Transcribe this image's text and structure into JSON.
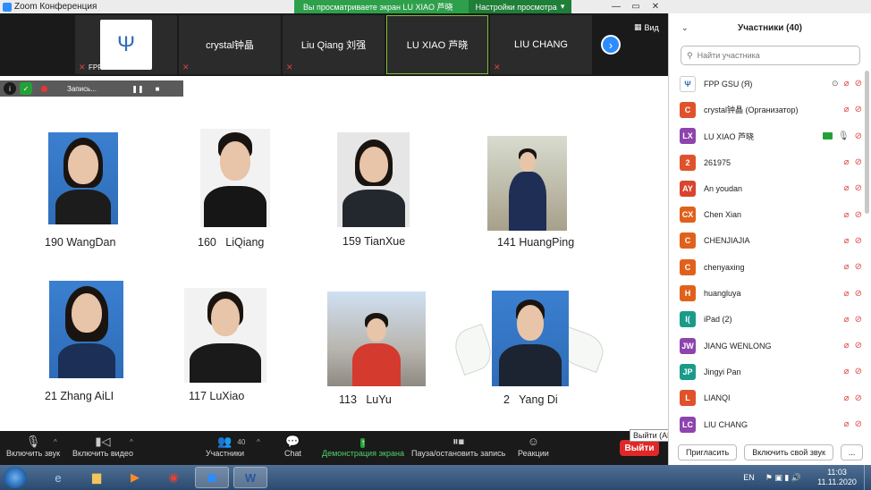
{
  "window": {
    "title": "Zoom Конференция"
  },
  "banner": {
    "message": "Вы просматриваете экран LU XIAO 芦晓",
    "options_label": "Настройки просмотра"
  },
  "strip": {
    "tiles": [
      {
        "name": "FPP GSU",
        "muted": true
      },
      {
        "name": "crystal钟晶",
        "muted": true
      },
      {
        "name": "Liu Qiang 刘强",
        "muted": true
      },
      {
        "name": "LU XIAO 芦晓",
        "muted": false,
        "active": true
      },
      {
        "name": "LIU CHANG",
        "muted": true
      }
    ],
    "view_label": "Вид"
  },
  "recording": {
    "label": "Запись..."
  },
  "slide": {
    "people": [
      {
        "caption": "190 WangDan"
      },
      {
        "caption": "160   LiQiang"
      },
      {
        "caption": "159 TianXue"
      },
      {
        "caption": "141 HuangPing"
      },
      {
        "caption": "21 Zhang AiLI"
      },
      {
        "caption": "117 LuXiao"
      },
      {
        "caption": "113   LuYu"
      },
      {
        "caption": "2   Yang Di"
      }
    ]
  },
  "toolbar": {
    "unmute": "Включить звук",
    "start_video": "Включить видео",
    "participants": "Участники",
    "participants_count": "40",
    "chat": "Chat",
    "share": "Демонстрация экрана",
    "pause_record": "Пауза/остановить запись",
    "reactions": "Реакции",
    "leave": "Выйти",
    "leave_tooltip": "Выйти (Alt+Q)"
  },
  "panel": {
    "title": "Участники (40)",
    "search_placeholder": "Найти участника",
    "participants": [
      {
        "initials": "",
        "name": "FPP GSU (Я)",
        "color": "#ffffff",
        "logo": true
      },
      {
        "initials": "C",
        "name": "crystal钟晶 (Организатор)",
        "color": "#e0522c"
      },
      {
        "initials": "LX",
        "name": "LU XIAO 芦晓",
        "color": "#8e44ad",
        "sharing": true
      },
      {
        "initials": "2",
        "name": "261975",
        "color": "#e0522c"
      },
      {
        "initials": "AY",
        "name": "An youdan",
        "color": "#d9442e"
      },
      {
        "initials": "CX",
        "name": "Chen Xian",
        "color": "#e0611c"
      },
      {
        "initials": "C",
        "name": "CHENJIAJIA",
        "color": "#e0611c"
      },
      {
        "initials": "C",
        "name": "chenyaxing",
        "color": "#e0611c"
      },
      {
        "initials": "H",
        "name": "huangluya",
        "color": "#e0611c"
      },
      {
        "initials": "I(",
        "name": "iPad (2)",
        "color": "#1a9b8a"
      },
      {
        "initials": "JW",
        "name": "JIANG WENLONG",
        "color": "#8e44ad"
      },
      {
        "initials": "JP",
        "name": "Jingyi Pan",
        "color": "#1a9b8a"
      },
      {
        "initials": "L",
        "name": "LIANQI",
        "color": "#e0522c"
      },
      {
        "initials": "LC",
        "name": "LIU CHANG",
        "color": "#8e44ad"
      }
    ],
    "invite": "Пригласить",
    "unmute_me": "Включить свой звук",
    "more": "..."
  },
  "taskbar": {
    "lang": "EN",
    "time": "11:03",
    "date": "11.11.2020"
  }
}
